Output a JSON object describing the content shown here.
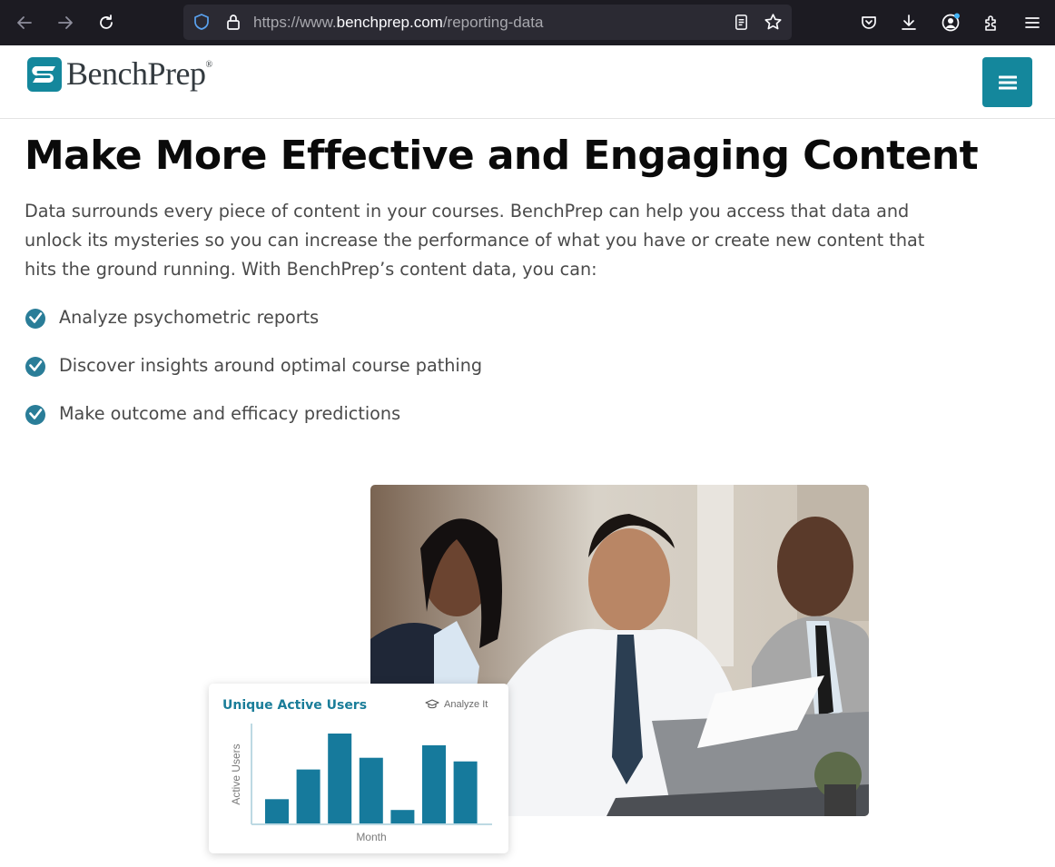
{
  "browser": {
    "url_prefix": "https://www.",
    "url_host": "benchprep.com",
    "url_path": "/reporting-data"
  },
  "header": {
    "logo_text": "BenchPrep",
    "logo_reg": "®"
  },
  "main": {
    "title": "Make More Effective and Engaging Content",
    "intro": "Data surrounds every piece of content in your courses. BenchPrep can help you access that data and unlock its mysteries so you can increase the performance of what you have or create new content that hits the ground running. With BenchPrep’s content data, you can:",
    "bullets": [
      "Analyze psychometric reports",
      "Discover insights around optimal course pathing",
      "Make outcome and efficacy predictions"
    ]
  },
  "card": {
    "title": "Unique Active Users",
    "action_label": "Analyze It"
  },
  "chart_data": {
    "type": "bar",
    "title": "Unique Active Users",
    "xlabel": "Month",
    "ylabel": "Active Users",
    "values": [
      27,
      60,
      100,
      73,
      15,
      87,
      69
    ],
    "color": "#167a9c",
    "grid": false
  },
  "colors": {
    "brand": "#14879c",
    "chart_bar": "#167a9c",
    "title_blue": "#1a7d99"
  }
}
